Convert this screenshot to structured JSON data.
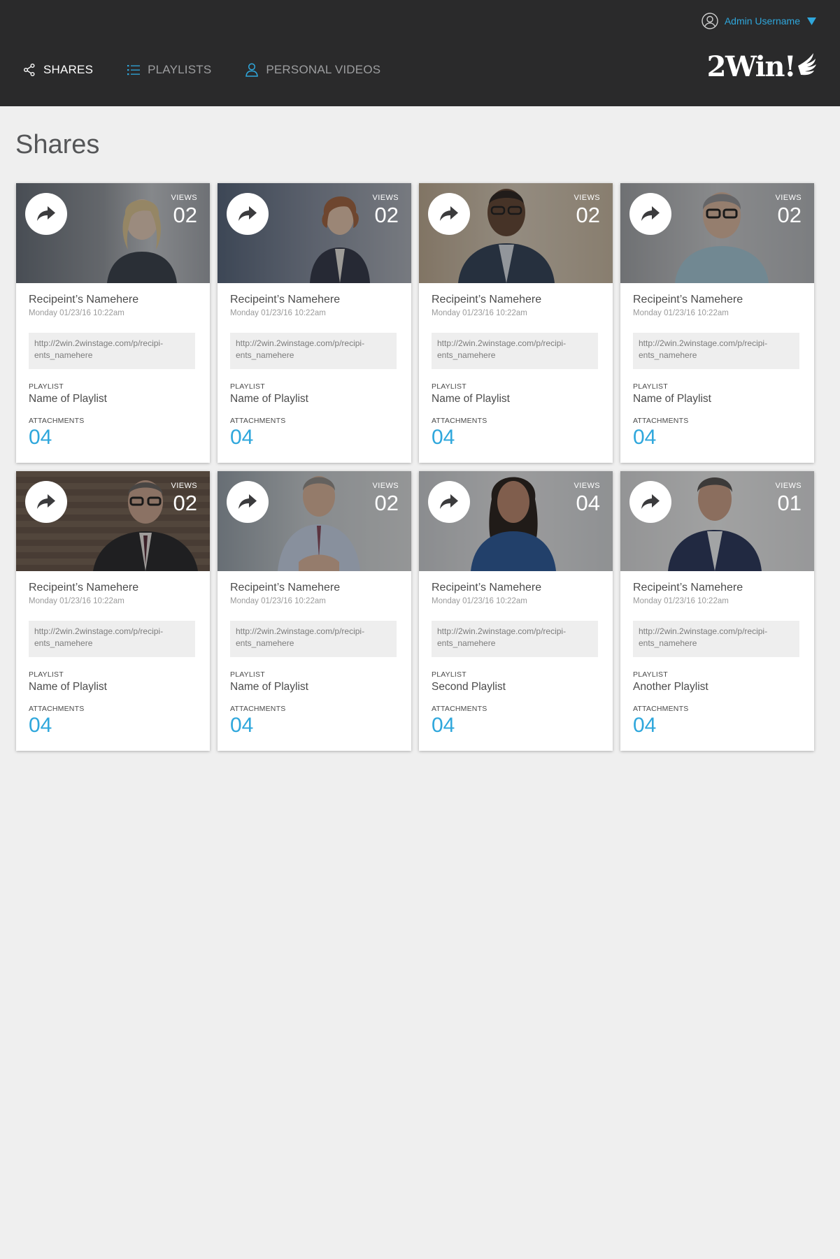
{
  "header": {
    "user_name": "Admin Username",
    "logo_text": "2Win!",
    "nav": [
      {
        "label": "SHARES",
        "active": true
      },
      {
        "label": "PLAYLISTS",
        "active": false
      },
      {
        "label": "PERSONAL VIDEOS",
        "active": false
      }
    ]
  },
  "page": {
    "title": "Shares"
  },
  "labels": {
    "views": "VIEWS",
    "playlist": "PLAYLIST",
    "attachments": "ATTACHMENTS"
  },
  "colors": {
    "accent": "#2fa7dc",
    "header_bg": "#2a2a2b",
    "page_bg": "#efefef"
  },
  "shares": [
    {
      "recipient": "Recipeint’s Namehere",
      "date": "Monday 01/23/16 10:22am",
      "link_line1": "http://2win.2winstage.com/p/recipi-",
      "link_line2": "ents_namehere",
      "views": "02",
      "playlist": "Name of Playlist",
      "attachments": "04"
    },
    {
      "recipient": "Recipeint’s Namehere",
      "date": "Monday 01/23/16 10:22am",
      "link_line1": "http://2win.2winstage.com/p/recipi-",
      "link_line2": "ents_namehere",
      "views": "02",
      "playlist": "Name of Playlist",
      "attachments": "04"
    },
    {
      "recipient": "Recipeint’s Namehere",
      "date": "Monday 01/23/16 10:22am",
      "link_line1": "http://2win.2winstage.com/p/recipi-",
      "link_line2": "ents_namehere",
      "views": "02",
      "playlist": "Name of Playlist",
      "attachments": "04"
    },
    {
      "recipient": "Recipeint’s Namehere",
      "date": "Monday 01/23/16 10:22am",
      "link_line1": "http://2win.2winstage.com/p/recipi-",
      "link_line2": "ents_namehere",
      "views": "02",
      "playlist": "Name of Playlist",
      "attachments": "04"
    },
    {
      "recipient": "Recipeint’s Namehere",
      "date": "Monday 01/23/16 10:22am",
      "link_line1": "http://2win.2winstage.com/p/recipi-",
      "link_line2": "ents_namehere",
      "views": "02",
      "playlist": "Name of Playlist",
      "attachments": "04"
    },
    {
      "recipient": "Recipeint’s Namehere",
      "date": "Monday 01/23/16 10:22am",
      "link_line1": "http://2win.2winstage.com/p/recipi-",
      "link_line2": "ents_namehere",
      "views": "02",
      "playlist": "Name of Playlist",
      "attachments": "04"
    },
    {
      "recipient": "Recipeint’s Namehere",
      "date": "Monday 01/23/16 10:22am",
      "link_line1": "http://2win.2winstage.com/p/recipi-",
      "link_line2": "ents_namehere",
      "views": "04",
      "playlist": "Second Playlist",
      "attachments": "04"
    },
    {
      "recipient": "Recipeint’s Namehere",
      "date": "Monday 01/23/16 10:22am",
      "link_line1": "http://2win.2winstage.com/p/recipi-",
      "link_line2": "ents_namehere",
      "views": "01",
      "playlist": "Another Playlist",
      "attachments": "04"
    }
  ]
}
